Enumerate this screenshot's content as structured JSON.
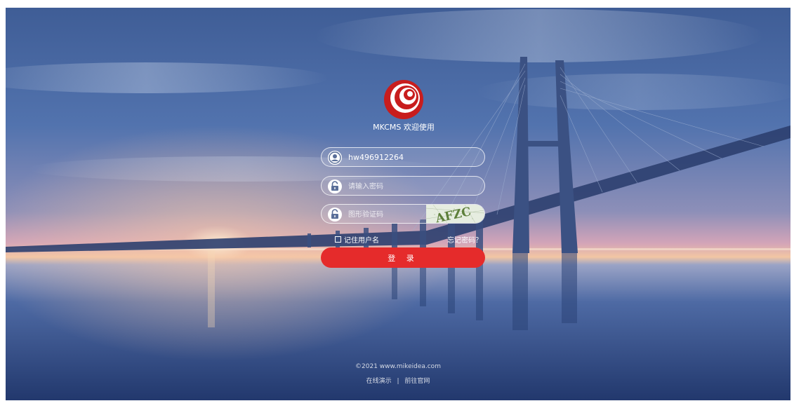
{
  "app": {
    "welcome": "MKCMS 欢迎使用"
  },
  "form": {
    "username_value": "hw496912264",
    "password_placeholder": "请输入密码",
    "captcha_placeholder": "图形验证码",
    "captcha_text": "AFZC",
    "remember_label": "记住用户名",
    "forgot_label": "忘记密码？",
    "login_label": "登 录"
  },
  "footer": {
    "copyright": "©2021 www.mikeidea.com",
    "link_demo": "在线演示",
    "separator": "|",
    "link_site": "前往官网"
  },
  "colors": {
    "accent": "#e52b2b",
    "sky_top": "#3d5c94",
    "water": "#27417a"
  },
  "icons": {
    "user": "user-icon",
    "lock": "lock-icon",
    "logo": "mkcms-logo-icon"
  }
}
